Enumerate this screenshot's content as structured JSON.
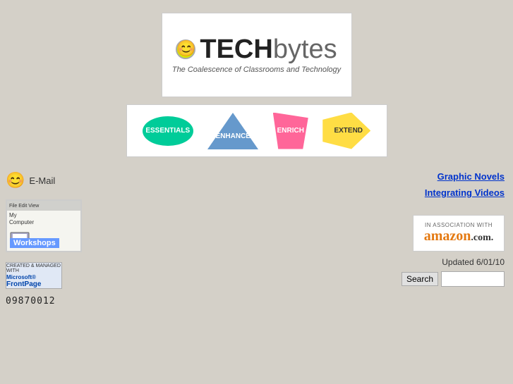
{
  "logo": {
    "tech": "TECH",
    "bytes": "bytes",
    "subtitle": "The Coalescence of Classrooms and Technology"
  },
  "nav": {
    "essentials": "ESSENTIALS",
    "enhance": "ENHANCE",
    "enrich": "ENRICH",
    "extend": "EXTEND"
  },
  "sidebar_left": {
    "email_label": "E-Mail",
    "workshops_label": "Workshops",
    "workshops_menubar": "File  Edit  View",
    "workshops_content": "My\nComputer",
    "frontpage_created": "CREATED & MANAGED WITH",
    "frontpage_logo": "FrontPage",
    "counter": "09870012"
  },
  "sidebar_right": {
    "graphic_novels": "Graphic Novels",
    "integrating_videos": "Integrating Videos",
    "amazon_assoc": "IN ASSOCIATION WITH",
    "amazon_logo": "amazon.com.",
    "updated": "Updated 6/01/10",
    "search_button": "Search",
    "search_placeholder": ""
  }
}
